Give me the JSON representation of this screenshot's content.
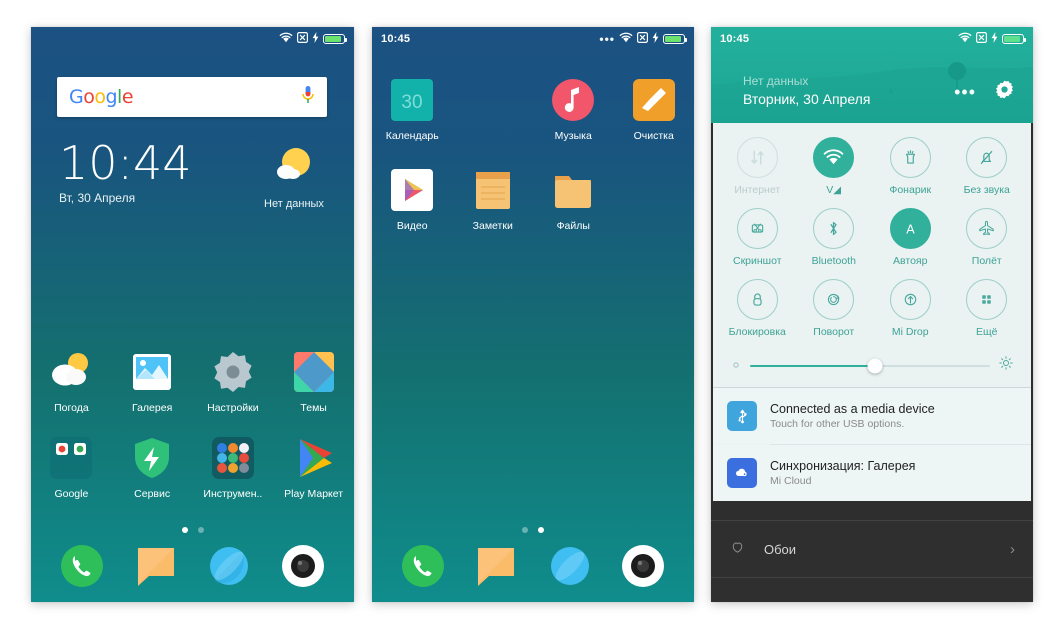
{
  "phone1": {
    "statusbar": {
      "time": "",
      "icons": [
        "wifi-icon",
        "no-sim-icon",
        "charging-icon",
        "battery-icon"
      ]
    },
    "search": {
      "logo_letters": [
        "G",
        "o",
        "o",
        "g",
        "l",
        "e"
      ],
      "mic_icon": "microphone-icon"
    },
    "clock": {
      "time": "10:44",
      "date": "Вт, 30 Апреля"
    },
    "weather": {
      "icon": "sun-cloud-icon",
      "label": "Нет данных"
    },
    "apps": [
      {
        "label": "Погода",
        "icon": "weather-app-icon"
      },
      {
        "label": "Галерея",
        "icon": "gallery-app-icon"
      },
      {
        "label": "Настройки",
        "icon": "settings-app-icon"
      },
      {
        "label": "Темы",
        "icon": "themes-app-icon"
      },
      {
        "label": "Google",
        "icon": "google-folder-icon"
      },
      {
        "label": "Сервис",
        "icon": "security-app-icon"
      },
      {
        "label": "Инструмен..",
        "icon": "tools-folder-icon"
      },
      {
        "label": "Play Маркет",
        "icon": "play-store-icon"
      }
    ],
    "pagedots": {
      "count": 2,
      "active": 0
    },
    "dock": [
      {
        "label": "Телефон",
        "icon": "phone-icon"
      },
      {
        "label": "SMS",
        "icon": "message-icon"
      },
      {
        "label": "Браузер",
        "icon": "browser-icon"
      },
      {
        "label": "Камера",
        "icon": "camera-icon"
      }
    ]
  },
  "phone2": {
    "statusbar": {
      "time": "10:45",
      "icons": [
        "more-dots-icon",
        "wifi-icon",
        "no-sim-icon",
        "charging-icon",
        "battery-icon"
      ]
    },
    "apps": [
      {
        "label": "Календарь",
        "icon": "calendar-app-icon",
        "day": "30"
      },
      {
        "label": "",
        "icon": ""
      },
      {
        "label": "Музыка",
        "icon": "music-app-icon"
      },
      {
        "label": "Очистка",
        "icon": "cleaner-app-icon"
      },
      {
        "label": "Видео",
        "icon": "video-app-icon"
      },
      {
        "label": "Заметки",
        "icon": "notes-app-icon"
      },
      {
        "label": "Файлы",
        "icon": "files-app-icon"
      },
      {
        "label": "",
        "icon": ""
      }
    ],
    "pagedots": {
      "count": 2,
      "active": 1
    },
    "dock": [
      {
        "label": "Телефон",
        "icon": "phone-icon"
      },
      {
        "label": "SMS",
        "icon": "message-icon"
      },
      {
        "label": "Браузер",
        "icon": "browser-icon"
      },
      {
        "label": "Камера",
        "icon": "camera-icon"
      }
    ]
  },
  "phone3": {
    "statusbar": {
      "time": "10:45",
      "icons": [
        "wifi-icon",
        "no-sim-icon",
        "charging-icon",
        "battery-icon"
      ]
    },
    "header": {
      "carrier": "Нет данных",
      "date": "Вторник, 30 Апреля",
      "more_icon": "more-dots-icon",
      "settings_icon": "gear-icon"
    },
    "toggles": [
      {
        "label": "Интернет",
        "icon": "data-transfer-icon",
        "state": "disabled"
      },
      {
        "label": "V◢",
        "icon": "wifi-icon",
        "state": "on"
      },
      {
        "label": "Фонарик",
        "icon": "flashlight-icon",
        "state": "off"
      },
      {
        "label": "Без звука",
        "icon": "bell-mute-icon",
        "state": "off"
      },
      {
        "label": "Скриншот",
        "icon": "screenshot-icon",
        "state": "off"
      },
      {
        "label": "Bluetooth",
        "icon": "bluetooth-icon",
        "state": "off"
      },
      {
        "label": "Автояр",
        "icon": "auto-brightness-icon",
        "state": "on"
      },
      {
        "label": "Полёт",
        "icon": "airplane-icon",
        "state": "off"
      },
      {
        "label": "Блокировка",
        "icon": "lock-icon",
        "state": "off"
      },
      {
        "label": "Поворот",
        "icon": "rotate-icon",
        "state": "off"
      },
      {
        "label": "Mi Drop",
        "icon": "mi-drop-icon",
        "state": "off"
      },
      {
        "label": "Ещё",
        "icon": "grid-more-icon",
        "state": "off"
      }
    ],
    "brightness": {
      "left_icon": "brightness-low-icon",
      "right_icon": "brightness-high-icon",
      "value": 52
    },
    "notifications": [
      {
        "title": "Connected as a media device",
        "subtitle": "Touch for other USB options.",
        "icon": "usb-icon",
        "color": "#40a5dd"
      },
      {
        "title": "Синхронизация: Галерея",
        "subtitle": "Mi Cloud",
        "icon": "cloud-sync-icon",
        "color": "#3b6fe0"
      }
    ],
    "bottom_row": {
      "label": "Обои",
      "icon": "wallpaper-icon",
      "chevron": "chevron-right-icon"
    }
  },
  "colors": {
    "accent_teal": "#31b09b",
    "panel_bg": "#eaf2f2",
    "dark_bar": "#2f2f2f",
    "home_top": "#1b5183",
    "home_bottom": "#0f8d8c"
  }
}
